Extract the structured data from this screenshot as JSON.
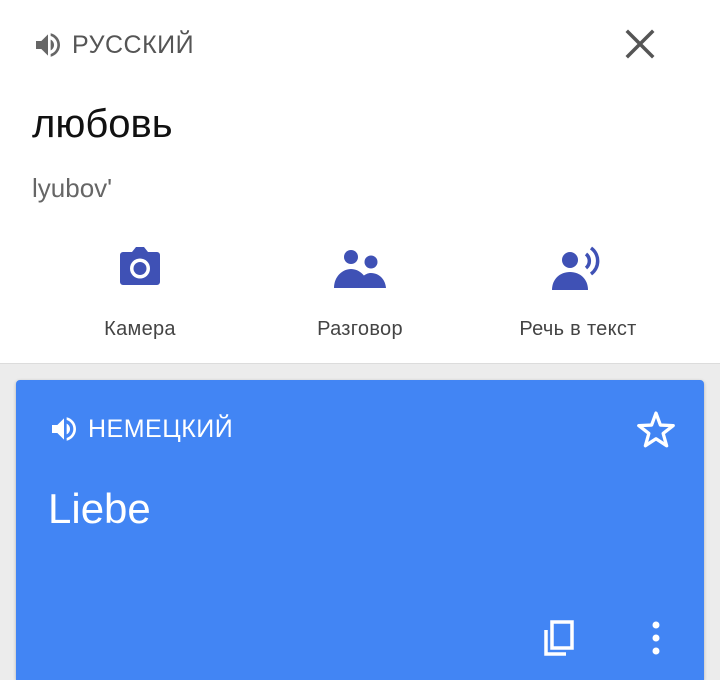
{
  "source": {
    "language": "РУССКИЙ",
    "text": "любовь",
    "transliteration": "lyubov'"
  },
  "actions": [
    {
      "label": "Камера",
      "icon": "camera-icon"
    },
    {
      "label": "Разговор",
      "icon": "conversation-icon"
    },
    {
      "label": "Речь в текст",
      "icon": "speech-to-text-icon"
    }
  ],
  "target": {
    "language": "НЕМЕЦКИЙ",
    "text": "Liebe"
  },
  "colors": {
    "accent": "#3f51b5",
    "card": "#4285f4",
    "muted_text": "#555555"
  }
}
